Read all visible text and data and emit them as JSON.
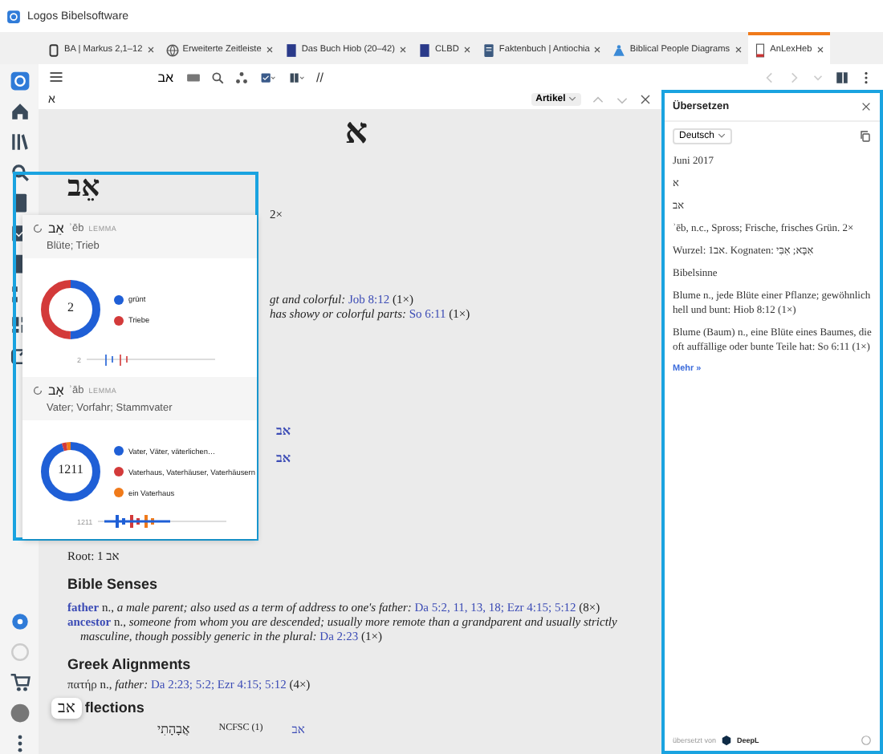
{
  "window": {
    "title": "Logos Bibelsoftware"
  },
  "tabs": [
    {
      "label": "BA | Markus 2,1–12",
      "kind": "document",
      "selected": false
    },
    {
      "label": "Erweiterte Zeitleiste",
      "kind": "globe",
      "selected": false
    },
    {
      "label": "Das Buch Hiob (20–42)",
      "kind": "book",
      "selected": false
    },
    {
      "label": "CLBD",
      "kind": "book",
      "selected": false
    },
    {
      "label": "Faktenbuch | Antiochia",
      "kind": "factbook",
      "selected": false
    },
    {
      "label": "Biblical People Diagrams",
      "kind": "diagram",
      "selected": false
    },
    {
      "label": "AnLexHeb",
      "kind": "lexicon",
      "selected": true
    }
  ],
  "toolbar": {
    "search_value": "אב",
    "separator": "//"
  },
  "article": {
    "header_letter": "א",
    "view_selector": "Artikel",
    "letter": "א",
    "headword": "אֵב",
    "count_fragment": "2×",
    "fragments": [
      {
        "text": "gt and colorful:",
        "ref": "Job 8:12",
        "count": "(1×)"
      },
      {
        "text": "has showy or colorful parts:",
        "ref": "So 6:11",
        "count": "(1×)"
      }
    ],
    "links": [
      "אב",
      "אב"
    ],
    "root": {
      "label": "Root: 1",
      "word": "אב"
    },
    "senses_heading": "Bible Senses",
    "senses": [
      {
        "term": "father",
        "pos": "n.,",
        "definition": "a male parent; also used as a term of address to one's father:",
        "refs": "Da 5:2, 11, 13, 18; Ezr 4:15; 5:12",
        "count": "(8×)"
      },
      {
        "term": "ancestor",
        "pos": "n.,",
        "definition": "someone from whom you are descended; usually more remote than a grandparent and usually strictly masculine, though possibly generic in the plural:",
        "refs": "Da 2:23",
        "count": "(1×)"
      }
    ],
    "alignments_heading": "Greek Alignments",
    "alignments": [
      {
        "term": "πατήρ",
        "pos": "n.,",
        "definition": "father:",
        "refs": "Da 2:23; 5:2; Ezr 4:15; 5:12",
        "count": "(4×)"
      }
    ],
    "inflections_heading": "flections",
    "hover_chip": "אב",
    "inflections": [
      {
        "form": "אֲבָהָתִי",
        "parsing": "NCFSC (1)",
        "lemma": "אב"
      }
    ]
  },
  "popup": {
    "entries": [
      {
        "lemma": "אֵב",
        "translit": "ʾēb",
        "tag": "LEMMA",
        "gloss": "Blüte; Trieb",
        "total": "2",
        "sparkline_label": "2",
        "legend": [
          {
            "label": "grünt",
            "color": "#1f5fd6"
          },
          {
            "label": "Triebe",
            "color": "#d33a3a"
          }
        ]
      },
      {
        "lemma": "אָב",
        "translit": "ʾāb",
        "tag": "LEMMA",
        "gloss": "Vater; Vorfahr; Stammvater",
        "total": "1211",
        "sparkline_label": "1211",
        "legend": [
          {
            "label": "Vater, Väter, väterlichen…",
            "color": "#1f5fd6"
          },
          {
            "label": "Vaterhaus, Vaterhäuser, Vaterhäusern",
            "color": "#d33a3a"
          },
          {
            "label": "ein Vaterhaus",
            "color": "#f07a1a"
          }
        ]
      }
    ]
  },
  "translate_panel": {
    "title": "Übersetzen",
    "language": "Deutsch",
    "paragraphs": [
      {
        "kind": "plain",
        "text": "Juni 2017"
      },
      {
        "kind": "plain",
        "text": "א"
      },
      {
        "kind": "plain",
        "text": "אב"
      },
      {
        "kind": "plain",
        "text": "ʾēb, n.c., Spross; Frische, frisches Grün. 2×"
      },
      {
        "kind": "plain",
        "text": "Wurzel: 1אב. Kognaten: אִבָּא; אִבִּי"
      },
      {
        "kind": "plain",
        "text": "Bibelsinne"
      },
      {
        "kind": "plain",
        "text": "Blume n., jede Blüte einer Pflanze; gewöhnlich hell und bunt: Hiob 8:12 (1×)"
      },
      {
        "kind": "plain",
        "text": "Blume (Baum) n., eine Blüte eines Baumes, die oft auffällige oder bunte Teile hat: So 6:11 (1×)"
      },
      {
        "kind": "link",
        "text": "Mehr »"
      }
    ],
    "footer_label": "übersetzt von",
    "provider": "DeepL"
  }
}
